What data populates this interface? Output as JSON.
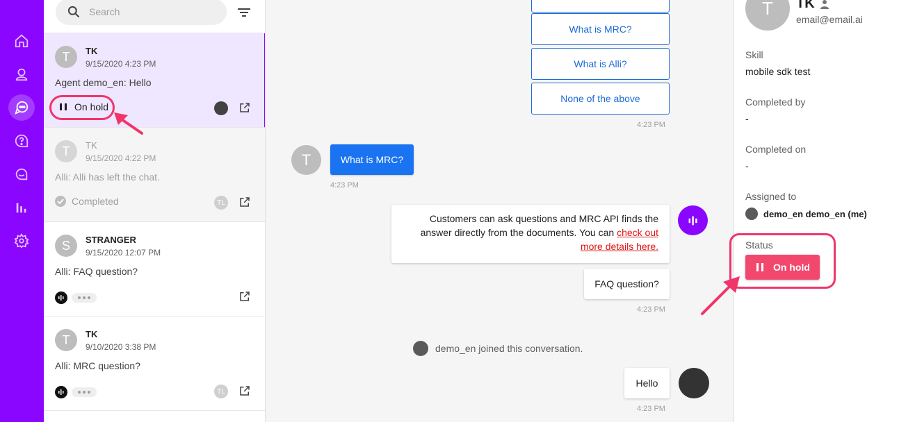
{
  "colors": {
    "brand": "#8a06ff",
    "highlight": "#f0356b",
    "onhold": "#f2486e",
    "primary": "#1a73f0"
  },
  "nav": {
    "items": [
      {
        "icon": "home-icon"
      },
      {
        "icon": "person-icon"
      },
      {
        "icon": "conversations-icon",
        "active": true
      },
      {
        "icon": "help-icon"
      },
      {
        "icon": "chat-bubble-icon"
      },
      {
        "icon": "analytics-icon"
      },
      {
        "icon": "settings-icon"
      }
    ]
  },
  "list": {
    "search_placeholder": "Search",
    "conversations": [
      {
        "avatar": "T",
        "name": "TK",
        "time": "9/15/2020 4:23 PM",
        "preview": "Agent demo_en: Hello",
        "status": "On hold"
      },
      {
        "avatar": "T",
        "name": "TK",
        "time": "9/15/2020 4:22 PM",
        "preview": "Alli: Alli has left the chat.",
        "status": "Completed",
        "agent": "TL"
      },
      {
        "avatar": "S",
        "name": "STRANGER",
        "time": "9/15/2020 12:07 PM",
        "preview": "Alli: FAQ question?"
      },
      {
        "avatar": "T",
        "name": "TK",
        "time": "9/10/2020 3:38 PM",
        "preview": "Alli: MRC question?",
        "agent": "TL"
      }
    ]
  },
  "chat": {
    "options": [
      "What is MRC?",
      "What is Alli?",
      "None of the above"
    ],
    "options_time": "4:23 PM",
    "user_avatar": "T",
    "user_message": "What is MRC?",
    "user_time": "4:23 PM",
    "bot_message_text": "Customers can ask questions and MRC API finds the answer directly from the documents. You can ",
    "bot_message_link": "check out more details here.",
    "faq_bubble": "FAQ question?",
    "faq_time": "4:23 PM",
    "joined_text": "demo_en joined this conversation.",
    "agent_message": "Hello",
    "agent_time": "4:23 PM"
  },
  "details": {
    "avatar": "T",
    "name": "TK",
    "email": "email@email.ai",
    "skill_label": "Skill",
    "skill_value": "mobile sdk test",
    "completed_by_label": "Completed by",
    "completed_by_value": "-",
    "completed_on_label": "Completed on",
    "completed_on_value": "-",
    "assigned_label": "Assigned to",
    "assigned_value": "demo_en demo_en (me)",
    "status_label": "Status",
    "status_value": "On hold"
  }
}
